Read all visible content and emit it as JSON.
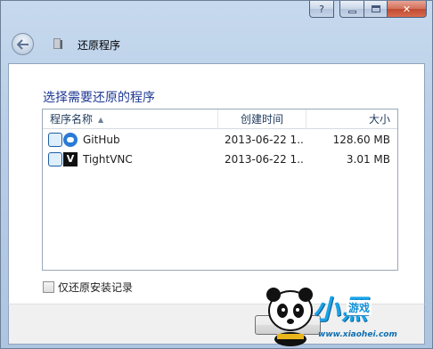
{
  "window": {
    "title": "还原程序",
    "caption": {
      "help": "?",
      "minimize": "",
      "maximize": "",
      "close": "✕"
    }
  },
  "main": {
    "heading": "选择需要还原的程序",
    "columns": {
      "name": "程序名称",
      "date": "创建时间",
      "size": "大小"
    },
    "sort_indicator": "▲",
    "rows": [
      {
        "name": "GitHub",
        "date": "2013-06-22 1...",
        "size": "128.60 MB",
        "icon": "github-icon"
      },
      {
        "name": "TightVNC",
        "date": "2013-06-22 1...",
        "size": "3.01 MB",
        "icon": "tightvnc-icon"
      }
    ],
    "checkbox_label": "仅还原安装记录",
    "vnc_glyph": "V"
  },
  "watermark": {
    "brand": "小黑",
    "sub": "游戏",
    "url": "www.xiaohei.com"
  },
  "colors": {
    "heading": "#1f3a93",
    "titlebar": "#c6d9ee",
    "close": "#c04a30"
  }
}
